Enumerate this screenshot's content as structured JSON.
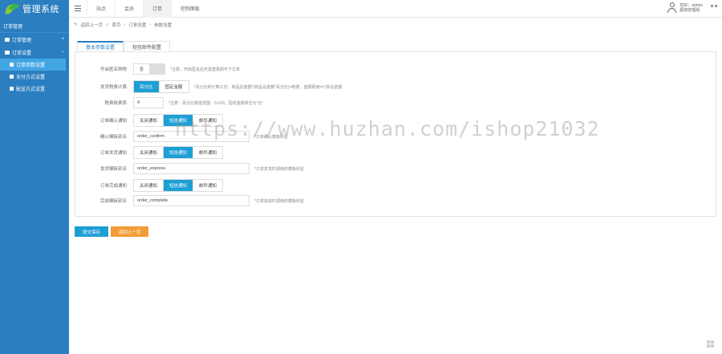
{
  "app": {
    "logo_text": "管理系统"
  },
  "sidebar": {
    "header": "订单管理",
    "groups": [
      {
        "label": "订单管理",
        "toggle": "+"
      },
      {
        "label": "订单设置",
        "toggle": "−"
      }
    ],
    "items": [
      {
        "label": "订单参数设置",
        "active": true
      },
      {
        "label": "支付方式设置",
        "active": false
      },
      {
        "label": "配送方式设置",
        "active": false
      }
    ]
  },
  "topbar": {
    "tabs": [
      "站点",
      "会员",
      "订单",
      "控制面板"
    ],
    "active_tab": "订单",
    "user_line1": "您好：admin",
    "user_line2": "超级管理组"
  },
  "breadcrumb": {
    "back": "返回上一页",
    "home": "首页",
    "level1": "订单设置",
    "level2": "参数设置"
  },
  "tabs": {
    "basic": "基本参数设置",
    "express": "短信邮件配置"
  },
  "form": {
    "guest": {
      "label": "开启匿名购物",
      "switch_text": "否",
      "hint": "*注意：开启匿名后无需登录即可下订单"
    },
    "calc": {
      "label": "发货税费计算",
      "options": [
        "百分比",
        "固定金额"
      ],
      "active": "百分比",
      "hint": "*百分比的计算公式：商品总金额*(商品总金额*百分比)=税费，金额费用=订单总金额"
    },
    "tax": {
      "label": "税费收费率",
      "value": "4",
      "hint": "*注意：百分比数值范围：0-100，固定金额单位为“元”"
    },
    "confirm_notify": {
      "label": "订单确认通知",
      "options": [
        "关闭通知",
        "短信通知",
        "邮件通知"
      ],
      "active": "短信通知"
    },
    "confirm_template": {
      "label": "确认模板别名",
      "value": "order_confirm",
      "hint": "*订单确认模板别名"
    },
    "ship_notify": {
      "label": "订单发货通知",
      "options": [
        "关闭通知",
        "短信通知",
        "邮件通知"
      ],
      "active": "短信通知"
    },
    "ship_template": {
      "label": "发货模板别名",
      "value": "order_express",
      "hint": "*订单发货时调用的模板别名"
    },
    "complete_notify": {
      "label": "订单完成通知",
      "options": [
        "关闭通知",
        "短信通知",
        "邮件通知"
      ],
      "active": "短信通知"
    },
    "complete_template": {
      "label": "完成模板别名",
      "value": "order_complete",
      "hint": "*订单完成时调用的模板别名"
    }
  },
  "buttons": {
    "save": "提交保存",
    "back": "返回上一页"
  },
  "watermark": "https://www.huzhan.com/ishop21032"
}
